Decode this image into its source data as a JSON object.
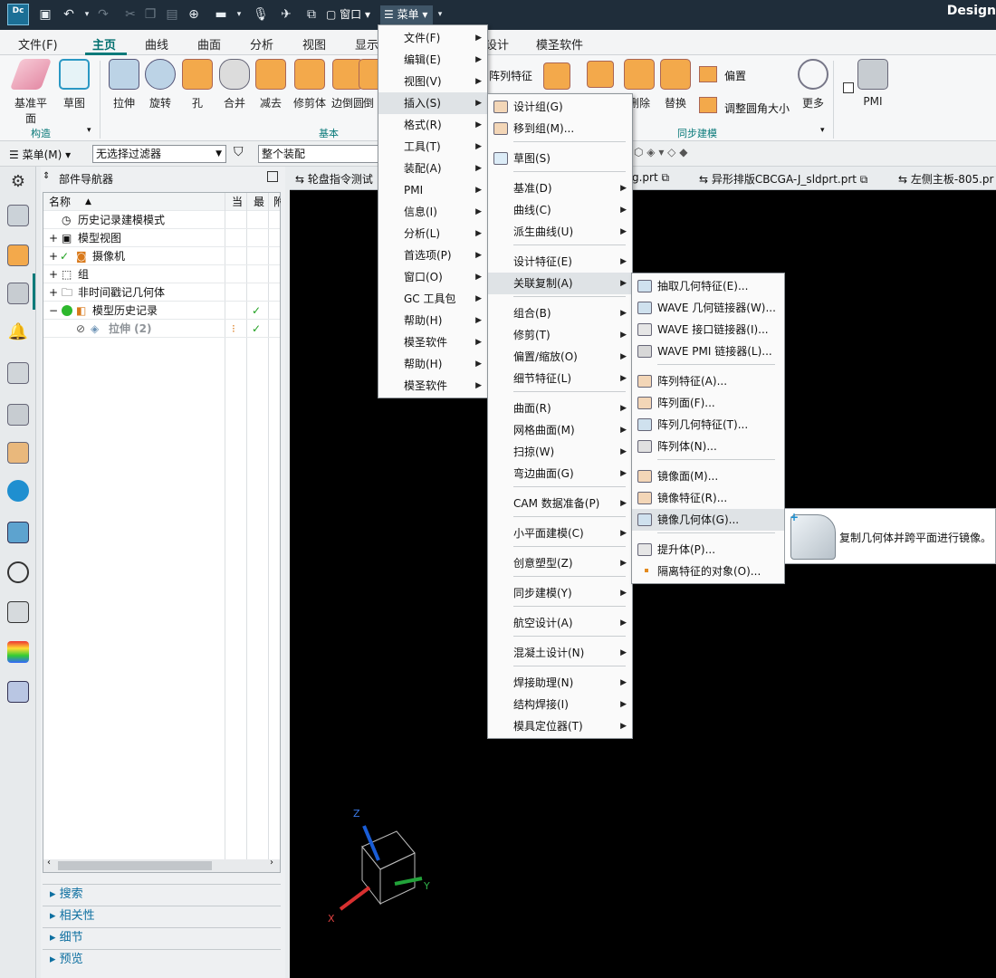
{
  "titlebar": {
    "logo": "Dc",
    "window_label": "窗口",
    "menu_label": "菜单",
    "app_title": "Design"
  },
  "ribbon": {
    "tabs": [
      "文件(F)",
      "主页",
      "曲线",
      "曲面",
      "分析",
      "视图",
      "显示",
      "设计",
      "模圣软件"
    ],
    "buttons": [
      "基准平面",
      "草图",
      "拉伸",
      "旋转",
      "孔",
      "合并",
      "减去",
      "修剪体",
      "边倒圆",
      "倒",
      "阵列特征",
      "删除",
      "替换",
      "偏置",
      "调整圆角大小",
      "更多",
      "PMI"
    ],
    "groups": [
      "构造",
      "基本",
      "同步建模"
    ]
  },
  "filterbar": {
    "menu_label": "菜单(M)",
    "filter_value": "无选择过滤器",
    "assembly_value": "整个装配"
  },
  "navigator": {
    "title": "部件导航器",
    "columns": [
      "名称",
      "当",
      "最",
      "附"
    ],
    "rows": [
      {
        "label": "历史记录建模模式"
      },
      {
        "label": "模型视图"
      },
      {
        "label": "摄像机"
      },
      {
        "label": "组"
      },
      {
        "label": "非时间戳记几何体"
      },
      {
        "label": "模型历史记录"
      },
      {
        "label": "拉伸 (2)"
      }
    ],
    "sections": [
      "搜索",
      "相关性",
      "细节",
      "预览"
    ]
  },
  "file_tabs": [
    "轮盘指令测试",
    "g.prt",
    "异形排版CBCGA-J_sldprt.prt",
    "左侧主板-805.pr"
  ],
  "main_menu": [
    {
      "label": "文件(F)"
    },
    {
      "label": "编辑(E)"
    },
    {
      "label": "视图(V)"
    },
    {
      "label": "插入(S)"
    },
    {
      "label": "格式(R)"
    },
    {
      "label": "工具(T)"
    },
    {
      "label": "装配(A)"
    },
    {
      "label": "PMI"
    },
    {
      "label": "信息(I)"
    },
    {
      "label": "分析(L)"
    },
    {
      "label": "首选项(P)"
    },
    {
      "label": "窗口(O)"
    },
    {
      "label": "GC 工具包"
    },
    {
      "label": "帮助(H)"
    },
    {
      "label": "模圣软件"
    },
    {
      "label": "帮助(H)"
    },
    {
      "label": "模圣软件"
    }
  ],
  "insert_menu": [
    {
      "label": "设计组(G)"
    },
    {
      "label": "移到组(M)..."
    },
    {
      "label": "草图(S)"
    },
    {
      "label": "基准(D)"
    },
    {
      "label": "曲线(C)"
    },
    {
      "label": "派生曲线(U)"
    },
    {
      "label": "设计特征(E)"
    },
    {
      "label": "关联复制(A)"
    },
    {
      "label": "组合(B)"
    },
    {
      "label": "修剪(T)"
    },
    {
      "label": "偏置/缩放(O)"
    },
    {
      "label": "细节特征(L)"
    },
    {
      "label": "曲面(R)"
    },
    {
      "label": "网格曲面(M)"
    },
    {
      "label": "扫掠(W)"
    },
    {
      "label": "弯边曲面(G)"
    },
    {
      "label": "CAM 数据准备(P)"
    },
    {
      "label": "小平面建模(C)"
    },
    {
      "label": "创意塑型(Z)"
    },
    {
      "label": "同步建模(Y)"
    },
    {
      "label": "航空设计(A)"
    },
    {
      "label": "混凝土设计(N)"
    },
    {
      "label": "焊接助理(N)"
    },
    {
      "label": "结构焊接(I)"
    },
    {
      "label": "模具定位器(T)"
    }
  ],
  "assoc_copy_menu": [
    {
      "label": "抽取几何特征(E)..."
    },
    {
      "label": "WAVE 几何链接器(W)..."
    },
    {
      "label": "WAVE 接口链接器(I)..."
    },
    {
      "label": "WAVE PMI 链接器(L)..."
    },
    {
      "label": "阵列特征(A)..."
    },
    {
      "label": "阵列面(F)..."
    },
    {
      "label": "阵列几何特征(T)..."
    },
    {
      "label": "阵列体(N)..."
    },
    {
      "label": "镜像面(M)..."
    },
    {
      "label": "镜像特征(R)..."
    },
    {
      "label": "镜像几何体(G)..."
    },
    {
      "label": "提升体(P)..."
    },
    {
      "label": "隔离特征的对象(O)..."
    }
  ],
  "tooltip": {
    "text": "复制几何体并跨平面进行镜像。"
  },
  "triad": {
    "x": "X",
    "y": "Y",
    "z": "Z"
  },
  "colors": {
    "accent": "#0a7a7a",
    "titlebar": "#1f2d3a",
    "highlight": "#dfe3e6"
  }
}
